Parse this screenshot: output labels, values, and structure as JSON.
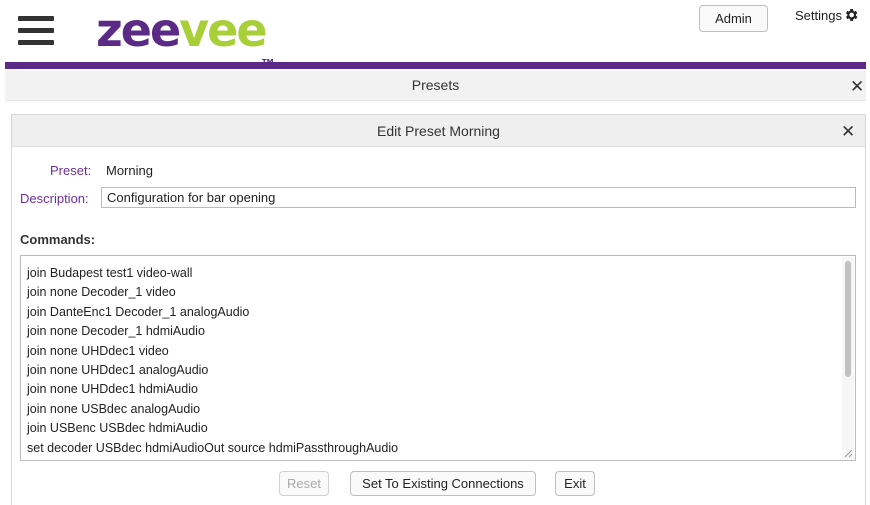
{
  "header": {
    "logo_part1": "zee",
    "logo_part2": "vee",
    "logo_tm": "TM",
    "admin_label": "Admin",
    "settings_label": "Settings"
  },
  "presets": {
    "title": "Presets",
    "close_symbol": "✕"
  },
  "edit": {
    "title": "Edit Preset Morning",
    "close_symbol": "✕",
    "preset_label": "Preset:",
    "preset_value": "Morning",
    "description_label": "Description:",
    "description_value": "Configuration for bar opening",
    "commands_label": "Commands:",
    "commands": [
      "join Budapest test1 video-wall",
      "join none Decoder_1 video",
      "join DanteEnc1 Decoder_1 analogAudio",
      "join none Decoder_1 hdmiAudio",
      "join none UHDdec1 video",
      "join none UHDdec1 analogAudio",
      "join none UHDdec1 hdmiAudio",
      "join none USBdec analogAudio",
      "join USBenc USBdec hdmiAudio",
      "set decoder USBdec hdmiAudioOut source hdmiPassthroughAudio"
    ],
    "buttons": {
      "reset": "Reset",
      "set_existing": "Set To Existing Connections",
      "exit": "Exit"
    }
  },
  "colors": {
    "brand_purple": "#5b2a86",
    "brand_green": "#a8cf38",
    "label_purple": "#6b2f9c"
  },
  "icons": [
    "hamburger-menu-icon",
    "gear-icon",
    "close-icon",
    "resize-grip-icon"
  ]
}
